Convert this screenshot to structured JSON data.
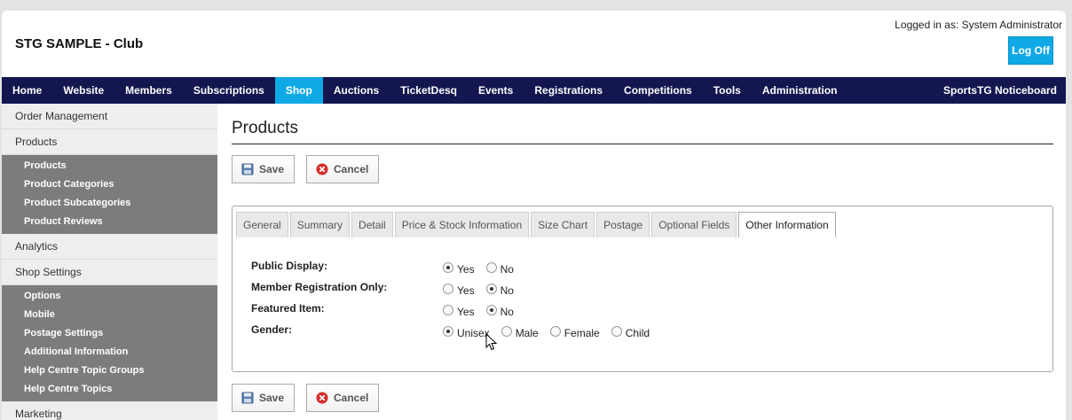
{
  "header": {
    "site_title": "STG SAMPLE - Club",
    "logged_in": "Logged in as: System Administrator",
    "logoff_label": "Log Off"
  },
  "nav": {
    "items": [
      "Home",
      "Website",
      "Members",
      "Subscriptions",
      "Shop",
      "Auctions",
      "TicketDesq",
      "Events",
      "Registrations",
      "Competitions",
      "Tools",
      "Administration"
    ],
    "active": "Shop",
    "right": "SportsTG Noticeboard"
  },
  "sidebar": {
    "order_management": "Order Management",
    "products": "Products",
    "products_sub": [
      "Products",
      "Product Categories",
      "Product Subcategories",
      "Product Reviews"
    ],
    "analytics": "Analytics",
    "shop_settings": "Shop Settings",
    "shop_settings_sub": [
      "Options",
      "Mobile",
      "Postage Settings",
      "Additional Information",
      "Help Centre Topic Groups",
      "Help Centre Topics"
    ],
    "marketing": "Marketing"
  },
  "main": {
    "title": "Products",
    "save_label": "Save",
    "cancel_label": "Cancel",
    "tabs": [
      "General",
      "Summary",
      "Detail",
      "Price & Stock Information",
      "Size Chart",
      "Postage",
      "Optional Fields",
      "Other Information"
    ],
    "active_tab": "Other Information",
    "fields": [
      {
        "label": "Public Display:",
        "options": [
          "Yes",
          "No"
        ],
        "selected": "Yes"
      },
      {
        "label": "Member Registration Only:",
        "options": [
          "Yes",
          "No"
        ],
        "selected": "No"
      },
      {
        "label": "Featured Item:",
        "options": [
          "Yes",
          "No"
        ],
        "selected": "No"
      },
      {
        "label": "Gender:",
        "options": [
          "Unisex",
          "Male",
          "Female",
          "Child"
        ],
        "selected": "Unisex"
      }
    ]
  },
  "colors": {
    "nav_bg": "#141650",
    "accent": "#0fa9e6",
    "sidebar_sub_bg": "#7c7c7c"
  }
}
